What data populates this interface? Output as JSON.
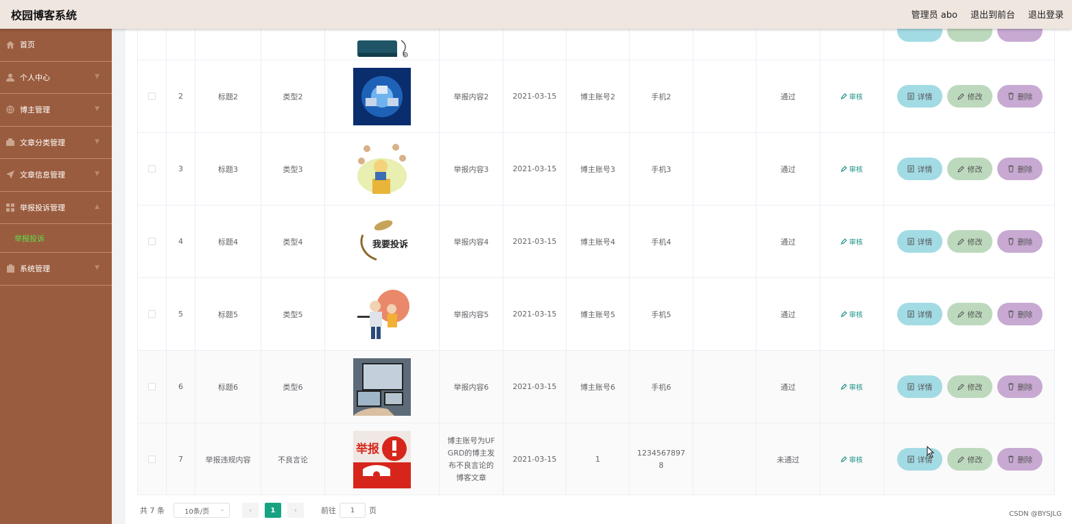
{
  "header": {
    "title": "校园博客系统",
    "admin_label": "管理员 abo",
    "front_label": "退出到前台",
    "logout_label": "退出登录"
  },
  "sidebar": {
    "items": [
      {
        "label": "首页",
        "icon": "home-icon"
      },
      {
        "label": "个人中心",
        "icon": "user-icon"
      },
      {
        "label": "博主管理",
        "icon": "globe-icon"
      },
      {
        "label": "文章分类管理",
        "icon": "folder-icon"
      },
      {
        "label": "文章信息管理",
        "icon": "send-icon"
      },
      {
        "label": "举报投诉管理",
        "icon": "grid-icon"
      },
      {
        "label": "系统管理",
        "icon": "settings-icon"
      }
    ],
    "sub_active": "举报投诉"
  },
  "table": {
    "rows": [
      {
        "no": "2",
        "title": "标题2",
        "type": "类型2",
        "content": "举报内容2",
        "date": "2021-03-15",
        "account": "博主账号2",
        "phone": "手机2",
        "status": "通过",
        "review": "审核"
      },
      {
        "no": "3",
        "title": "标题3",
        "type": "类型3",
        "content": "举报内容3",
        "date": "2021-03-15",
        "account": "博主账号3",
        "phone": "手机3",
        "status": "通过",
        "review": "审核"
      },
      {
        "no": "4",
        "title": "标题4",
        "type": "类型4",
        "content": "举报内容4",
        "date": "2021-03-15",
        "account": "博主账号4",
        "phone": "手机4",
        "status": "通过",
        "review": "审核"
      },
      {
        "no": "5",
        "title": "标题5",
        "type": "类型5",
        "content": "举报内容5",
        "date": "2021-03-15",
        "account": "博主账号5",
        "phone": "手机5",
        "status": "通过",
        "review": "审核"
      },
      {
        "no": "6",
        "title": "标题6",
        "type": "类型6",
        "content": "举报内容6",
        "date": "2021-03-15",
        "account": "博主账号6",
        "phone": "手机6",
        "status": "通过",
        "review": "审核"
      },
      {
        "no": "7",
        "title": "举报违规内容",
        "type": "不良言论",
        "content_lines": [
          "博主账号为UF",
          "GRD的博主发",
          "布不良言论的",
          "博客文章"
        ],
        "date": "2021-03-15",
        "account": "1",
        "phone_lines": [
          "1234567897",
          "8"
        ],
        "status": "未通过",
        "review": "审核"
      }
    ],
    "btn_detail": "详情",
    "btn_edit": "修改",
    "btn_delete": "删除",
    "image_signs": {
      "row4": "我要投诉",
      "row7": "举报"
    }
  },
  "pagination": {
    "total": "共 7 条",
    "page_size": "10条/页",
    "current_page": "1",
    "goto_prefix": "前往",
    "goto_value": "1",
    "goto_suffix": "页"
  },
  "watermark": "CSDN @BYSJLG",
  "colors": {
    "sidebar": "#9a5c3e",
    "accent": "#17a382",
    "active_sub": "#5ce04a"
  }
}
